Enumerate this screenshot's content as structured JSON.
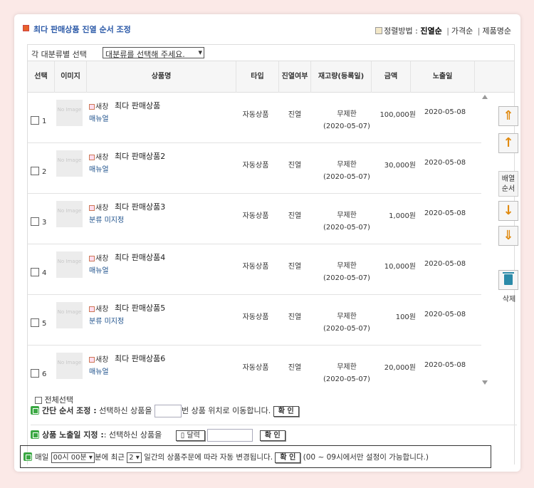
{
  "header": {
    "title": "최다 판매상품 진열 순서 조정",
    "sort_label": "정렬방법 :",
    "sort_options": [
      "진열순",
      "가격순",
      "제품명순"
    ]
  },
  "category": {
    "label": "각 대분류별 선택",
    "select_value": "대분류를 선택해 주세요."
  },
  "table": {
    "columns": [
      "선택",
      "이미지",
      "상품명",
      "타입",
      "진열여부",
      "재고량(등록일)",
      "금액",
      "노출일"
    ],
    "rows": [
      {
        "num": "1",
        "img": "No Image",
        "newwin": "새창",
        "name": "최다 판매상품",
        "cat": "매뉴얼",
        "type": "자동상품",
        "display": "진열",
        "stock": "무제한",
        "regdate": "(2020-05-07)",
        "price": "100,000원",
        "date": "2020-05-08"
      },
      {
        "num": "2",
        "img": "No Image",
        "newwin": "새창",
        "name": "최다 판매상품2",
        "cat": "매뉴얼",
        "type": "자동상품",
        "display": "진열",
        "stock": "무제한",
        "regdate": "(2020-05-07)",
        "price": "30,000원",
        "date": "2020-05-08"
      },
      {
        "num": "3",
        "img": "No Image",
        "newwin": "새창",
        "name": "최다 판매상품3",
        "cat": "분류 미지정",
        "type": "자동상품",
        "display": "진열",
        "stock": "무제한",
        "regdate": "(2020-05-07)",
        "price": "1,000원",
        "date": "2020-05-08"
      },
      {
        "num": "4",
        "img": "No Image",
        "newwin": "새창",
        "name": "최다 판매상품4",
        "cat": "매뉴얼",
        "type": "자동상품",
        "display": "진열",
        "stock": "무제한",
        "regdate": "(2020-05-07)",
        "price": "10,000원",
        "date": "2020-05-08"
      },
      {
        "num": "5",
        "img": "No Image",
        "newwin": "새창",
        "name": "최다 판매상품5",
        "cat": "분류 미지정",
        "type": "자동상품",
        "display": "진열",
        "stock": "무제한",
        "regdate": "(2020-05-07)",
        "price": "100원",
        "date": "2020-05-08"
      },
      {
        "num": "6",
        "img": "No Image",
        "newwin": "새창",
        "name": "최다 판매상품6",
        "cat": "매뉴얼",
        "type": "자동상품",
        "display": "진열",
        "stock": "무제한",
        "regdate": "(2020-05-07)",
        "price": "20,000원",
        "date": "2020-05-08"
      }
    ]
  },
  "side": {
    "order_label": "배열\n순서",
    "delete_label": "삭제"
  },
  "footer": {
    "select_all": "전체선택",
    "quick_title": "간단 순서 조정 :",
    "quick_text_a": "선택하신 상품을",
    "quick_text_b": "번 상품 위치로 이동합니다.",
    "confirm": "확 인",
    "expose_title": "상품 노출일 지정 :",
    "expose_text": ": 선택하신 상품을",
    "calendar": "달력",
    "auto_a": "매일",
    "auto_time": "00시 00분",
    "auto_b": "분에 최근",
    "auto_days": "2",
    "auto_c": "일간의 상품주문에 따라 자동 변경됩니다.",
    "auto_note": "(00 ~ 09시에서만 설정이 가능합니다.)"
  },
  "colors": {
    "accent": "#2c5aa8",
    "icon_green": "#3aa843",
    "arrow_orange": "#e08a10"
  }
}
